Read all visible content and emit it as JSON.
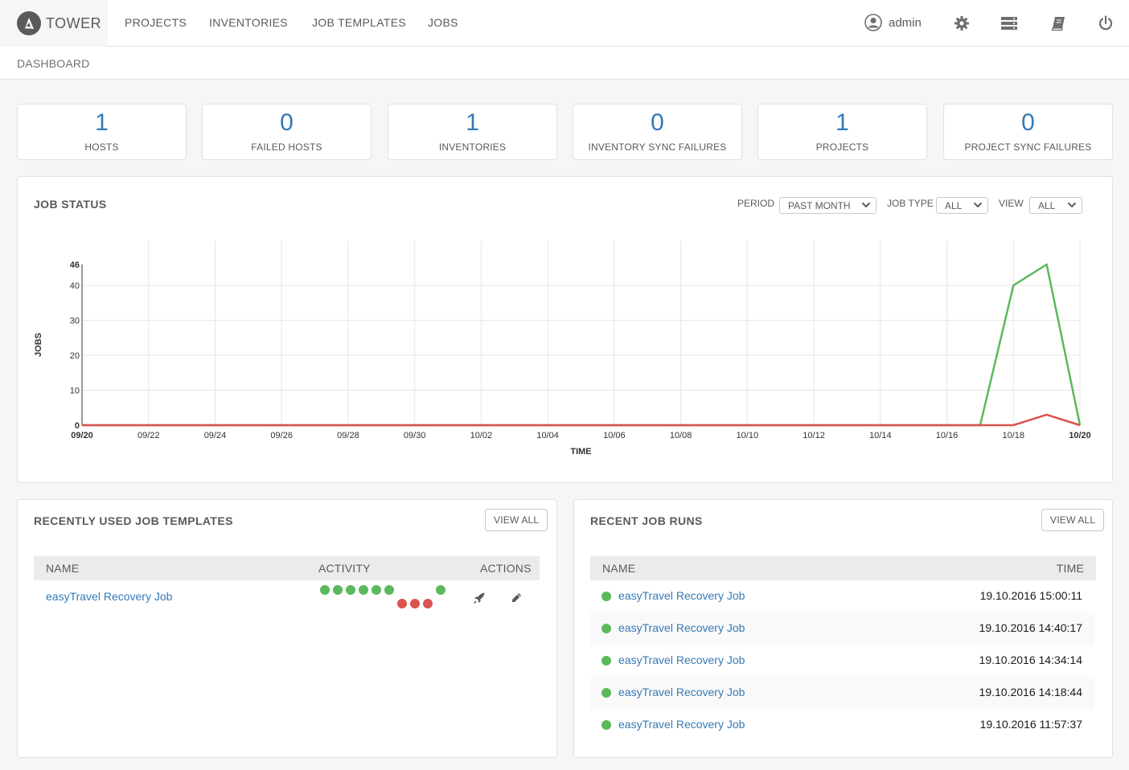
{
  "app": {
    "name": "TOWER"
  },
  "nav": {
    "items": [
      "PROJECTS",
      "INVENTORIES",
      "JOB TEMPLATES",
      "JOBS"
    ],
    "user": "admin",
    "icons": [
      "user-icon",
      "gear-icon",
      "server-icon",
      "book-icon",
      "power-icon"
    ]
  },
  "breadcrumb": "DASHBOARD",
  "counts": [
    {
      "value": "1",
      "label": "HOSTS"
    },
    {
      "value": "0",
      "label": "FAILED HOSTS"
    },
    {
      "value": "1",
      "label": "INVENTORIES"
    },
    {
      "value": "0",
      "label": "INVENTORY SYNC FAILURES"
    },
    {
      "value": "1",
      "label": "PROJECTS"
    },
    {
      "value": "0",
      "label": "PROJECT SYNC FAILURES"
    }
  ],
  "job_status": {
    "title": "JOB STATUS",
    "period_label": "PERIOD",
    "period_value": "PAST MONTH",
    "job_type_label": "JOB TYPE",
    "job_type_value": "ALL",
    "view_label": "VIEW",
    "view_value": "ALL"
  },
  "chart_data": {
    "type": "line",
    "xlabel": "TIME",
    "ylabel": "JOBS",
    "ylim": [
      0,
      46
    ],
    "yticks": [
      0,
      10,
      20,
      30,
      40,
      46
    ],
    "x": [
      "09/20",
      "09/21",
      "09/22",
      "09/23",
      "09/24",
      "09/25",
      "09/26",
      "09/27",
      "09/28",
      "09/29",
      "09/30",
      "10/01",
      "10/02",
      "10/03",
      "10/04",
      "10/05",
      "10/06",
      "10/07",
      "10/08",
      "10/09",
      "10/10",
      "10/11",
      "10/12",
      "10/13",
      "10/14",
      "10/15",
      "10/16",
      "10/17",
      "10/18",
      "10/19",
      "10/20"
    ],
    "xtick_labels": [
      "09/20",
      "09/22",
      "09/24",
      "09/26",
      "09/28",
      "09/30",
      "10/02",
      "10/04",
      "10/06",
      "10/08",
      "10/10",
      "10/12",
      "10/14",
      "10/16",
      "10/18",
      "10/20"
    ],
    "grid": true,
    "series": [
      {
        "color": "#5cb85c",
        "values": [
          0,
          0,
          0,
          0,
          0,
          0,
          0,
          0,
          0,
          0,
          0,
          0,
          0,
          0,
          0,
          0,
          0,
          0,
          0,
          0,
          0,
          0,
          0,
          0,
          0,
          0,
          0,
          0,
          40,
          46,
          0
        ]
      },
      {
        "color": "#d9534f",
        "values": [
          0,
          0,
          0,
          0,
          0,
          0,
          0,
          0,
          0,
          0,
          0,
          0,
          0,
          0,
          0,
          0,
          0,
          0,
          0,
          0,
          0,
          0,
          0,
          0,
          0,
          0,
          0,
          0,
          0,
          3,
          0
        ]
      }
    ]
  },
  "templates": {
    "title": "RECENTLY USED JOB TEMPLATES",
    "view_all": "VIEW ALL",
    "col_name": "NAME",
    "col_activity": "ACTIVITY",
    "col_actions": "ACTIONS",
    "rows": [
      {
        "name": "easyTravel Recovery Job",
        "activity": [
          "success",
          "success",
          "success",
          "success",
          "success",
          "success",
          "failed",
          "failed",
          "failed",
          "success"
        ]
      }
    ]
  },
  "runs": {
    "title": "RECENT JOB RUNS",
    "view_all": "VIEW ALL",
    "col_name": "NAME",
    "col_time": "TIME",
    "rows": [
      {
        "name": "easyTravel Recovery Job",
        "time": "19.10.2016 15:00:11",
        "status": "success"
      },
      {
        "name": "easyTravel Recovery Job",
        "time": "19.10.2016 14:40:17",
        "status": "success"
      },
      {
        "name": "easyTravel Recovery Job",
        "time": "19.10.2016 14:34:14",
        "status": "success"
      },
      {
        "name": "easyTravel Recovery Job",
        "time": "19.10.2016 14:18:44",
        "status": "success"
      },
      {
        "name": "easyTravel Recovery Job",
        "time": "19.10.2016 11:57:37",
        "status": "success"
      }
    ]
  },
  "colors": {
    "success": "#5cb85c",
    "failed": "#d9534f",
    "accent": "#337ab7"
  }
}
